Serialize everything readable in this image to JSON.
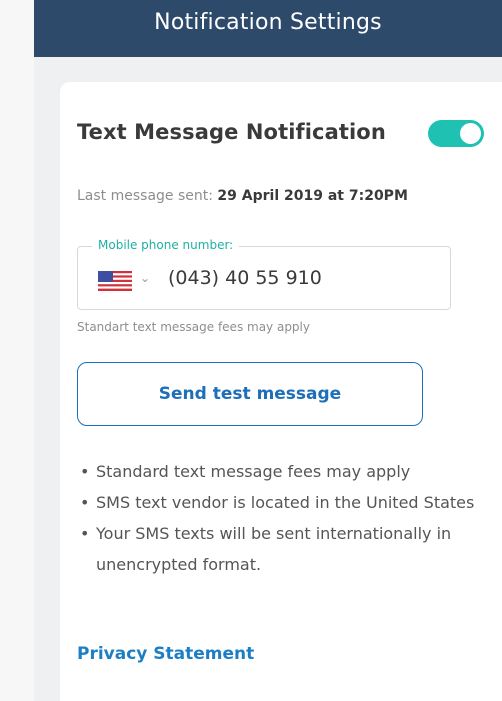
{
  "header": {
    "title": "Notification Settings"
  },
  "card": {
    "title": "Text Message Notification",
    "toggle": {
      "state": "on",
      "color": "#1fc1b2"
    },
    "last_sent_label": "Last message sent: ",
    "last_sent_value": "29 April 2019 at 7:20PM",
    "phone_field": {
      "legend": "Mobile phone number:",
      "country_flag_icon": "us-flag-icon",
      "value": "(043) 40 55 910"
    },
    "fees_hint": "Standart text message fees may apply",
    "test_button_label": "Send test message",
    "bullets": [
      "Standard text message fees may apply",
      "SMS text vendor is located in the United States",
      "Your SMS texts will be sent internationally in unencrypted format."
    ],
    "privacy_link": "Privacy Statement"
  },
  "colors": {
    "header_bg": "#2e4a6b",
    "accent_teal": "#1fc1b2",
    "link_blue": "#1c7ec4"
  }
}
